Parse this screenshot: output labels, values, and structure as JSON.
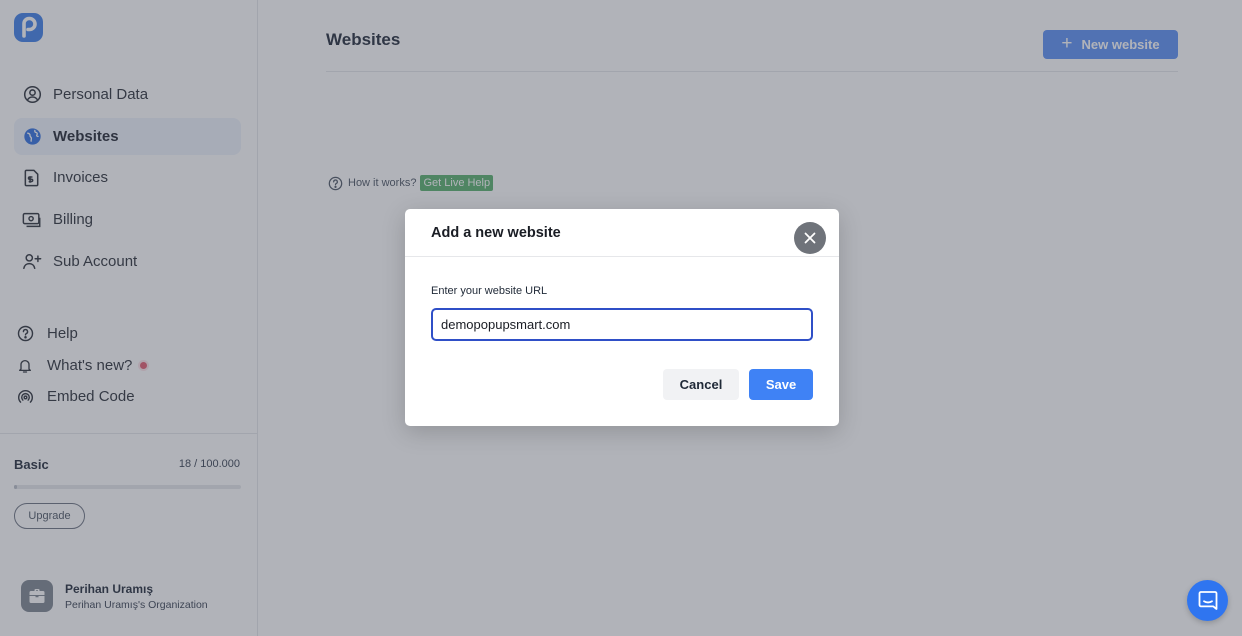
{
  "brand": {
    "logo_icon": "popupsmart-logo-icon",
    "accent": "#3f82f5"
  },
  "sidebar": {
    "items": [
      {
        "label": "Personal Data",
        "icon": "user-circle-icon",
        "active": false
      },
      {
        "label": "Websites",
        "icon": "globe-icon",
        "active": true
      },
      {
        "label": "Invoices",
        "icon": "invoice-icon",
        "active": false
      },
      {
        "label": "Billing",
        "icon": "billing-icon",
        "active": false
      },
      {
        "label": "Sub Account",
        "icon": "add-user-icon",
        "active": false
      }
    ],
    "secondary": [
      {
        "label": "Help",
        "icon": "help-circle-icon"
      },
      {
        "label": "What's new?",
        "icon": "bell-icon",
        "badge": "notification-dot"
      },
      {
        "label": "Embed Code",
        "icon": "broadcast-icon"
      }
    ],
    "plan": {
      "name": "Basic",
      "usage": "18 / 100.000",
      "fraction": 0.00018,
      "upgrade_label": "Upgrade"
    },
    "user": {
      "name": "Perihan Uramış",
      "organization": "Perihan Uramış's Organization",
      "avatar_icon": "briefcase-icon"
    }
  },
  "main": {
    "title": "Websites",
    "new_button": "New website",
    "how_it_works": "How it works?",
    "live_help": "Get Live Help"
  },
  "modal": {
    "title": "Add a new website",
    "field_label": "Enter your website URL",
    "url_value": "demopopupsmart.com",
    "cancel_label": "Cancel",
    "save_label": "Save"
  },
  "chat": {
    "icon": "chat-bubble-icon"
  }
}
